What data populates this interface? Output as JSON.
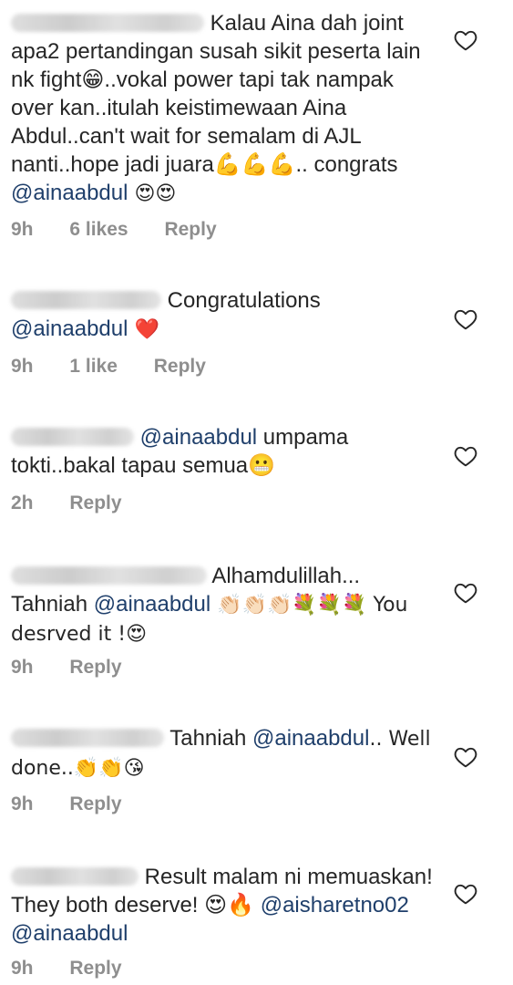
{
  "comments": [
    {
      "pre": "",
      "mention_inline": "",
      "text": "Kalau Aina dah joint apa2 pertandingan susah sikit peserta lain nk fight😁..vokal power tapi tak nampak over kan..itulah keistimewaan Aina Abdul..can't wait for semalam di AJL nanti..hope jadi juara💪💪💪.. congrats ",
      "mention": "@ainaabdul",
      "after": " 😍😍",
      "time": "9h",
      "likes": "6 likes",
      "reply": "Reply"
    },
    {
      "text": "Congratulations ",
      "mention": "@ainaabdul",
      "after": " ❤️",
      "time": "9h",
      "likes": "1 like",
      "reply": "Reply"
    },
    {
      "mention": "@ainaabdul",
      "after": " umpama tokti..bakal tapau semua😬",
      "time": "2h",
      "likes": "",
      "reply": "Reply"
    },
    {
      "text": "Alhamdulillah... Tahniah ",
      "mention": "@ainaabdul",
      "after": " 👏🏻👏🏻👏🏻💐💐💐 You desrved it !😍",
      "time": "9h",
      "likes": "",
      "reply": "Reply"
    },
    {
      "text": "Tahniah ",
      "mention": "@ainaabdul",
      "after": ".. Well done..👏👏😘",
      "time": "9h",
      "likes": "",
      "reply": "Reply"
    },
    {
      "text": "Result malam ni memuaskan! They both deserve! 😍🔥 ",
      "mention": "@aisharetno02",
      "mention2": "@ainaabdul",
      "time": "9h",
      "likes": "",
      "reply": "Reply"
    }
  ]
}
